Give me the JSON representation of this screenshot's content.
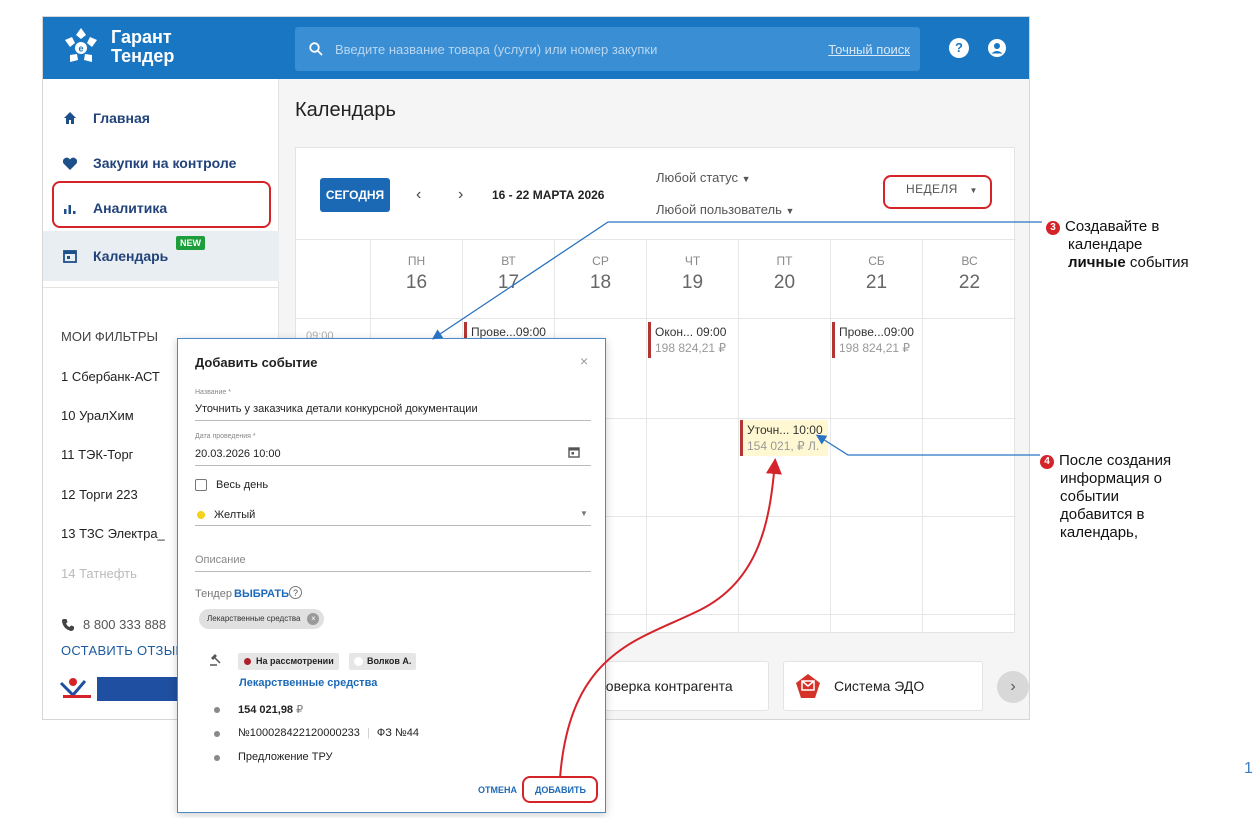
{
  "app": {
    "logo_line1": "Гарант",
    "logo_line2": "Тендер",
    "search_placeholder": "Введите название товара (услуги) или номер закупки",
    "exact_search": "Точный поиск"
  },
  "sidebar": {
    "items": [
      {
        "label": "Главная"
      },
      {
        "label": "Закупки на контроле"
      },
      {
        "label": "Аналитика"
      },
      {
        "label": "Календарь"
      }
    ],
    "new_badge": "NEW",
    "filters_title": "МОИ ФИЛЬТРЫ",
    "filters": [
      "1 Сбербанк-АСТ",
      "10 УралХим",
      "11 ТЭК-Торг",
      "12 Торги 223",
      "13 ТЗС Электра_",
      "14 Татнефть"
    ],
    "phone": "8 800 333 888",
    "feedback": "ОСТАВИТЬ ОТЗЫВ"
  },
  "calendar": {
    "page_title": "Календарь",
    "today_button": "СЕГОДНЯ",
    "prev": "‹",
    "next": "›",
    "range": "16 - 22 МАРТА 2026",
    "status_filter": "Любой статус",
    "user_filter": "Любой пользователь",
    "view_mode": "НЕДЕЛЯ",
    "time_label": "09:00",
    "days": [
      {
        "dow": "ПН",
        "num": "16"
      },
      {
        "dow": "ВТ",
        "num": "17"
      },
      {
        "dow": "СР",
        "num": "18"
      },
      {
        "dow": "ЧТ",
        "num": "19"
      },
      {
        "dow": "ПТ",
        "num": "20"
      },
      {
        "dow": "СБ",
        "num": "21"
      },
      {
        "dow": "ВС",
        "num": "22"
      }
    ],
    "events": [
      {
        "title": "Прове...09:00",
        "sub": ""
      },
      {
        "title": "Окон... 09:00",
        "sub": "198 824,21 ₽"
      },
      {
        "title": "Прове...09:00",
        "sub": "198 824,21 ₽"
      },
      {
        "title": "Уточн... 10:00",
        "sub": "154 021, ₽ Л."
      }
    ]
  },
  "bottom": {
    "chip1": "роверка контрагента",
    "chip2": "Система ЭДО",
    "next": "›"
  },
  "dialog": {
    "title": "Добавить событие",
    "close": "×",
    "name_label": "Название *",
    "name_value": "Уточнить у заказчика детали конкурсной документации",
    "date_label": "Дата проведения *",
    "date_value": "20.03.2026 10:00",
    "all_day": "Весь день",
    "color": "Желтый",
    "description": "Описание",
    "tender_label": "Тендер",
    "choose": "ВЫБРАТЬ",
    "help": "?",
    "tag": "Лекарственные средства",
    "status_pill": "На рассмотрении",
    "user_pill": "Волков А.",
    "tender_link": "Лекарственные средства",
    "price": "154 021,98",
    "currency": "₽",
    "number": "№100028422120000233",
    "law": "ФЗ №44",
    "type": "Предложение ТРУ",
    "cancel": "ОТМЕНА",
    "add": "ДОБАВИТЬ"
  },
  "annotations": {
    "note3_num": "3",
    "note3_l1": "Создавайте в",
    "note3_l2": "календаре",
    "note3_bold": "личные",
    "note3_l3": " события",
    "note4_num": "4",
    "note4_l1": "После создания",
    "note4_l2": "информация о",
    "note4_l3": "событии",
    "note4_l4": "добавится в",
    "note4_l5": "календарь,",
    "page_number": "1"
  }
}
